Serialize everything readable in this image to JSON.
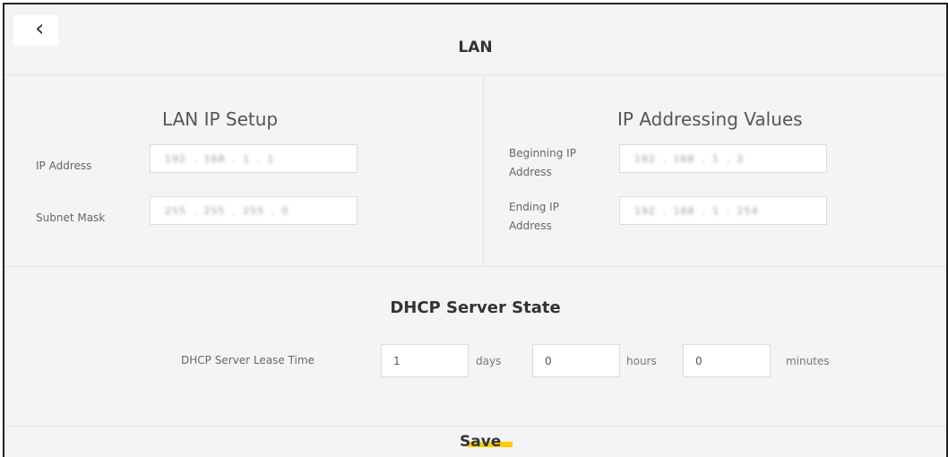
{
  "header": {
    "title": "LAN",
    "back_glyph": "‹"
  },
  "lan_ip_setup": {
    "title": "LAN IP Setup",
    "ip_address_label": "IP Address",
    "ip_address_octets": [
      "192",
      "168",
      "1",
      "1"
    ],
    "subnet_mask_label": "Subnet Mask",
    "subnet_mask_octets": [
      "255",
      "255",
      "255",
      "0"
    ]
  },
  "ip_addressing": {
    "title": "IP Addressing Values",
    "beginning_label_line1": "Beginning IP",
    "beginning_label_line2": "Address",
    "beginning_octets": [
      "192",
      "168",
      "1",
      "2"
    ],
    "ending_label_line1": "Ending IP",
    "ending_label_line2": "Address",
    "ending_octets": [
      "192",
      "168",
      "1",
      "254"
    ]
  },
  "dhcp": {
    "title": "DHCP Server State",
    "lease_label": "DHCP Server Lease Time",
    "days_value": "1",
    "days_unit": "days",
    "hours_value": "0",
    "hours_unit": "hours",
    "minutes_value": "0",
    "minutes_unit": "minutes"
  },
  "footer": {
    "save_label": "Save",
    "accent_color": "#ffcc00"
  }
}
